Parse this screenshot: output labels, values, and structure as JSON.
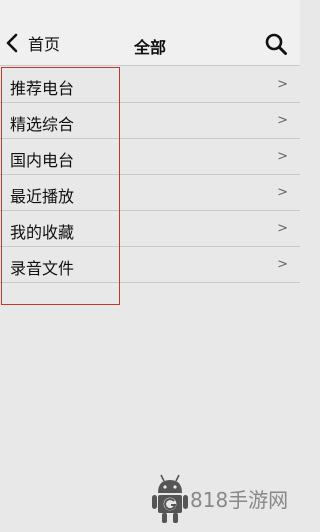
{
  "header": {
    "back_label": "首页",
    "title": "全部"
  },
  "icons": {
    "back": "chevron-left-icon",
    "search": "search-icon",
    "item_arrow": "chevron-right-icon",
    "watermark": "android-robot-icon"
  },
  "list": {
    "items": [
      {
        "label": "推荐电台",
        "arrow": ">"
      },
      {
        "label": "精选综合",
        "arrow": ">"
      },
      {
        "label": "国内电台",
        "arrow": ">"
      },
      {
        "label": "最近播放",
        "arrow": ">"
      },
      {
        "label": "我的收藏",
        "arrow": ">"
      },
      {
        "label": "录音文件",
        "arrow": ">"
      }
    ]
  },
  "watermark": {
    "text": "818手游网"
  },
  "colors": {
    "background": "#e8e8e8",
    "header_bg": "#f0f0f0",
    "divider": "#c8c8c8",
    "highlight_border": "#c0392b"
  }
}
